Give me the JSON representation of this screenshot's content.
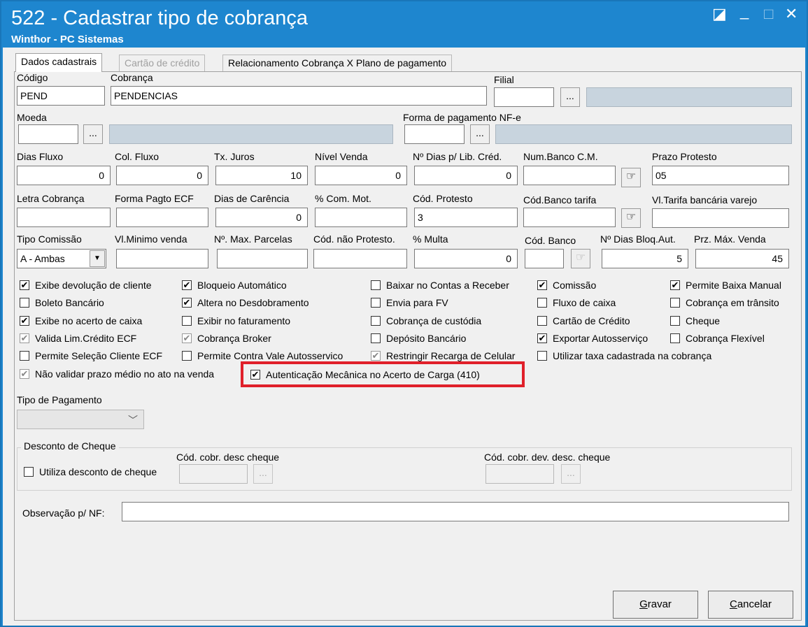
{
  "window": {
    "title": "522 - Cadastrar tipo de cobrança",
    "subtitle": "Winthor - PC Sistemas",
    "controls": [
      "◪",
      "_",
      "□",
      "✕"
    ]
  },
  "tabs": [
    {
      "label": "Dados cadastrais",
      "state": "active"
    },
    {
      "label": "Cartão de crédito",
      "state": "disabled"
    },
    {
      "label": "Relacionamento Cobrança X Plano de pagamento",
      "state": "normal"
    }
  ],
  "fields": {
    "codigo": {
      "label": "Código",
      "value": "PEND"
    },
    "cobranca": {
      "label": "Cobrança",
      "value": "PENDENCIAS"
    },
    "filial": {
      "label": "Filial",
      "value": ""
    },
    "moeda": {
      "label": "Moeda",
      "value": ""
    },
    "forma_pag_nfe": {
      "label": "Forma de pagamento NF-e",
      "value": ""
    },
    "dias_fluxo": {
      "label": "Dias Fluxo",
      "value": "0"
    },
    "col_fluxo": {
      "label": "Col. Fluxo",
      "value": "0"
    },
    "tx_juros": {
      "label": "Tx. Juros",
      "value": "10"
    },
    "nivel_venda": {
      "label": "Nível Venda",
      "value": "0"
    },
    "dias_lib_cred": {
      "label": "Nº Dias p/ Lib. Créd.",
      "value": "0"
    },
    "num_banco_cm": {
      "label": "Num.Banco C.M.",
      "value": ""
    },
    "prazo_protesto": {
      "label": "Prazo Protesto",
      "value": "05"
    },
    "letra_cobranca": {
      "label": "Letra Cobrança",
      "value": ""
    },
    "forma_pagto_ecf": {
      "label": "Forma Pagto ECF",
      "value": ""
    },
    "dias_carencia": {
      "label": "Dias de Carência",
      "value": "0"
    },
    "com_mot": {
      "label": "% Com. Mot.",
      "value": ""
    },
    "cod_protesto": {
      "label": "Cód. Protesto",
      "value": "3"
    },
    "cod_banco_tarifa": {
      "label": "Cód.Banco tarifa",
      "value": ""
    },
    "vl_tarifa_varejo": {
      "label": "Vl.Tarifa bancária varejo",
      "value": ""
    },
    "tipo_comissao": {
      "label": "Tipo Comissão",
      "value": "A - Ambas"
    },
    "vl_minimo_venda": {
      "label": "Vl.Minimo venda",
      "value": ""
    },
    "max_parcelas": {
      "label": "Nº. Max. Parcelas",
      "value": ""
    },
    "cod_nao_protesto": {
      "label": "Cód. não Protesto.",
      "value": ""
    },
    "multa": {
      "label": "% Multa",
      "value": "0"
    },
    "cod_banco": {
      "label": "Cód. Banco",
      "value": ""
    },
    "dias_bloq_aut": {
      "label": "Nº Dias Bloq.Aut.",
      "value": "5"
    },
    "prz_max_venda": {
      "label": "Prz. Máx. Venda",
      "value": "45"
    }
  },
  "checkboxes": [
    {
      "label": "Exibe devolução de cliente",
      "checked": true,
      "dim": false
    },
    {
      "label": "Boleto Bancário",
      "checked": false,
      "dim": false
    },
    {
      "label": "Exibe no acerto de caixa",
      "checked": true,
      "dim": false
    },
    {
      "label": "Valida Lim.Crédito ECF",
      "checked": true,
      "dim": true
    },
    {
      "label": "Permite Seleção Cliente ECF",
      "checked": false,
      "dim": false
    },
    {
      "label": "Não validar prazo médio no ato na venda",
      "checked": true,
      "dim": true
    },
    {
      "label": "Bloqueio Automático",
      "checked": true,
      "dim": false
    },
    {
      "label": "Altera no Desdobramento",
      "checked": true,
      "dim": false
    },
    {
      "label": "Exibir no faturamento",
      "checked": false,
      "dim": false
    },
    {
      "label": "Cobrança Broker",
      "checked": true,
      "dim": true
    },
    {
      "label": "Permite Contra Vale Autosservico",
      "checked": false,
      "dim": false
    },
    {
      "label": "Autenticação Mecânica no Acerto de Carga (410)",
      "checked": true,
      "dim": false
    },
    {
      "label": "Baixar no Contas a Receber",
      "checked": false,
      "dim": false
    },
    {
      "label": "Envia para FV",
      "checked": false,
      "dim": false
    },
    {
      "label": "Cobrança de custódia",
      "checked": false,
      "dim": false
    },
    {
      "label": "Depósito Bancário",
      "checked": false,
      "dim": false
    },
    {
      "label": "Restringir Recarga de Celular",
      "checked": true,
      "dim": true
    },
    {
      "label": "Comissão",
      "checked": true,
      "dim": false
    },
    {
      "label": "Fluxo de caixa",
      "checked": false,
      "dim": false
    },
    {
      "label": "Cartão de Crédito",
      "checked": false,
      "dim": false
    },
    {
      "label": "Exportar Autosserviço",
      "checked": true,
      "dim": false
    },
    {
      "label": "Utilizar taxa cadastrada na cobrança",
      "checked": false,
      "dim": false
    },
    {
      "label": "Permite Baixa Manual",
      "checked": true,
      "dim": false
    },
    {
      "label": "Cobrança em trânsito",
      "checked": false,
      "dim": false
    },
    {
      "label": "Cheque",
      "checked": false,
      "dim": false
    },
    {
      "label": "Cobrança Flexível",
      "checked": false,
      "dim": false
    }
  ],
  "tipo_pagamento": {
    "label": "Tipo de Pagamento",
    "value": ""
  },
  "desconto_cheque": {
    "group_label": "Desconto de Cheque",
    "utiliza_label": "Utiliza desconto de cheque",
    "utiliza_checked": false,
    "cod_desc_label": "Cód. cobr. desc cheque",
    "cod_dev_label": "Cód. cobr. dev. desc. cheque"
  },
  "observacao": {
    "label": "Observação p/ NF:",
    "value": ""
  },
  "buttons": {
    "ellipsis": "...",
    "gravar_first": "G",
    "gravar_rest": "ravar",
    "cancelar_first": "C",
    "cancelar_rest": "ancelar"
  },
  "icons": {
    "picker": "☞",
    "dropdown": "▼",
    "check": "✔"
  }
}
